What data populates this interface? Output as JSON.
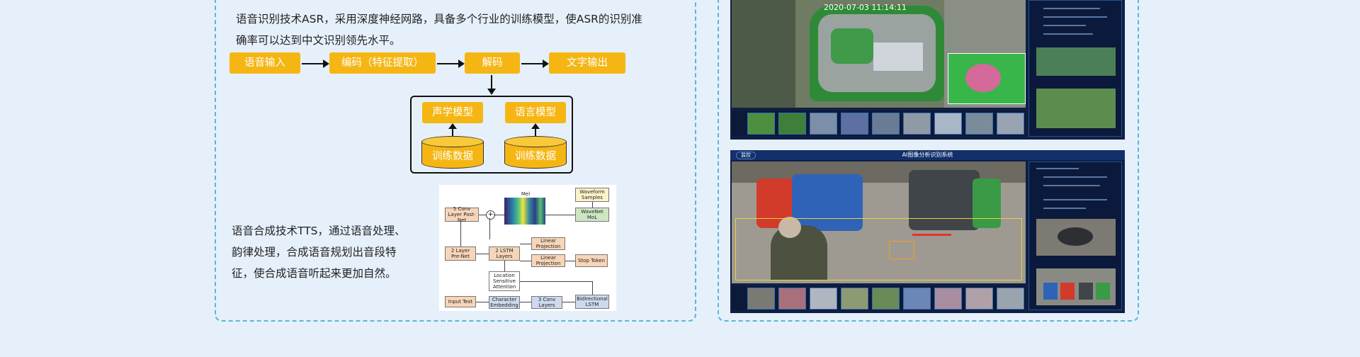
{
  "asr": {
    "desc_line1": "语音识别技术ASR，采用深度神经网路，具备多个行业的训练模型，使ASR的识别准",
    "desc_line2": "确率可以达到中文识别领先水平。",
    "steps": [
      "语音输入",
      "编码（特征提取）",
      "解码",
      "文字输出"
    ],
    "models": [
      "声学模型",
      "语言模型"
    ],
    "data_label": "训练数据"
  },
  "tts": {
    "desc_line1": "语音合成技术TTS，通过语音处理、",
    "desc_line2": "韵律处理，合成语音规划出音段特",
    "desc_line3": "征，使合成语音听起来更加自然。",
    "diagram": {
      "mel_title": "Mel Spectrogram",
      "waveform_samples": "Waveform Samples",
      "wavenet": "WaveNet MoL",
      "postnet": "5 Conv Layer Post-Net",
      "prenet": "2 Layer Pre-Net",
      "lstm": "2 LSTM Layers",
      "linear1": "Linear Projection",
      "linear2": "Linear Projection",
      "stop": "Stop Token",
      "attention": "Location Sensitive Attention",
      "input": "Input Text",
      "char_emb": "Character Embedding",
      "conv3": "3 Conv Layers",
      "bilstm": "Bidirectional LSTM"
    }
  },
  "monitor": {
    "top_timestamp": "2020-07-03 11:14:11",
    "bottom_title": "AI图像分析识别系统",
    "bottom_tag": "监控"
  },
  "colors": {
    "accent": "#f5b614",
    "panel_border": "#5bb6d6",
    "background": "#e6f0fb",
    "screen_bg": "#0f1f44"
  }
}
